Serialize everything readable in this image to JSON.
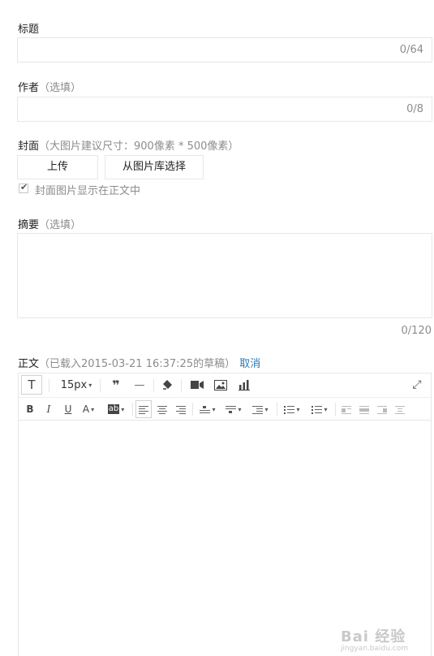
{
  "title_field": {
    "label": "标题",
    "counter": "0/64",
    "value": ""
  },
  "author_field": {
    "label": "作者",
    "hint": "（选填）",
    "counter": "0/8",
    "value": ""
  },
  "cover": {
    "label": "封面",
    "hint": "（大图片建议尺寸：900像素 * 500像素）",
    "upload_label": "上传",
    "library_label": "从图片库选择",
    "show_in_body_label": "封面图片显示在正文中",
    "show_in_body_checked": true
  },
  "summary_field": {
    "label": "摘要",
    "hint": "（选填）",
    "counter": "0/120",
    "value": ""
  },
  "body": {
    "label": "正文",
    "draft_notice": "（已载入2015-03-21 16:37:25的草稿）",
    "cancel_label": "取消"
  },
  "toolbar": {
    "font_size": "15px",
    "row1_icons": [
      "text-style-icon",
      "font-size-select",
      "quote-icon",
      "horizontal-rule-icon",
      "clear-format-icon",
      "video-icon",
      "image-icon",
      "chart-icon",
      "fullscreen-icon"
    ],
    "row2_icons": [
      "bold-icon",
      "italic-icon",
      "underline-icon",
      "font-color-icon",
      "background-color-icon",
      "align-left-icon",
      "align-center-icon",
      "align-right-icon",
      "spacing-before-icon",
      "spacing-after-icon",
      "line-height-icon",
      "ordered-list-icon",
      "unordered-list-icon",
      "table-icons"
    ],
    "bold_glyph": "B",
    "italic_glyph": "I",
    "underline_glyph": "U",
    "font_color_glyph": "A",
    "bg_color_glyph": "ab",
    "text_glyph": "T",
    "quote_glyph": "❞",
    "rule_glyph": "—"
  },
  "watermark": {
    "brand": "Bai 经验",
    "url": "jingyan.baidu.com"
  }
}
